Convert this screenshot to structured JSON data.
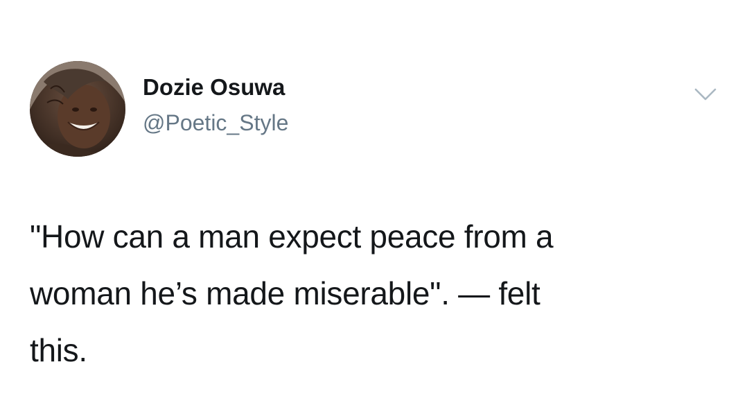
{
  "tweet": {
    "author_name": "Dozie Osuwa",
    "author_handle": "@Poetic_Style",
    "text": "\"How can a man expect peace from a\nwoman he’s made miserable\". — felt\nthis.",
    "menu_icon": "chevron-down-icon",
    "avatar_icon": "profile-photo"
  },
  "colors": {
    "name": "#14171a",
    "handle": "#657786",
    "caret": "#aab8c2",
    "background": "#ffffff"
  }
}
